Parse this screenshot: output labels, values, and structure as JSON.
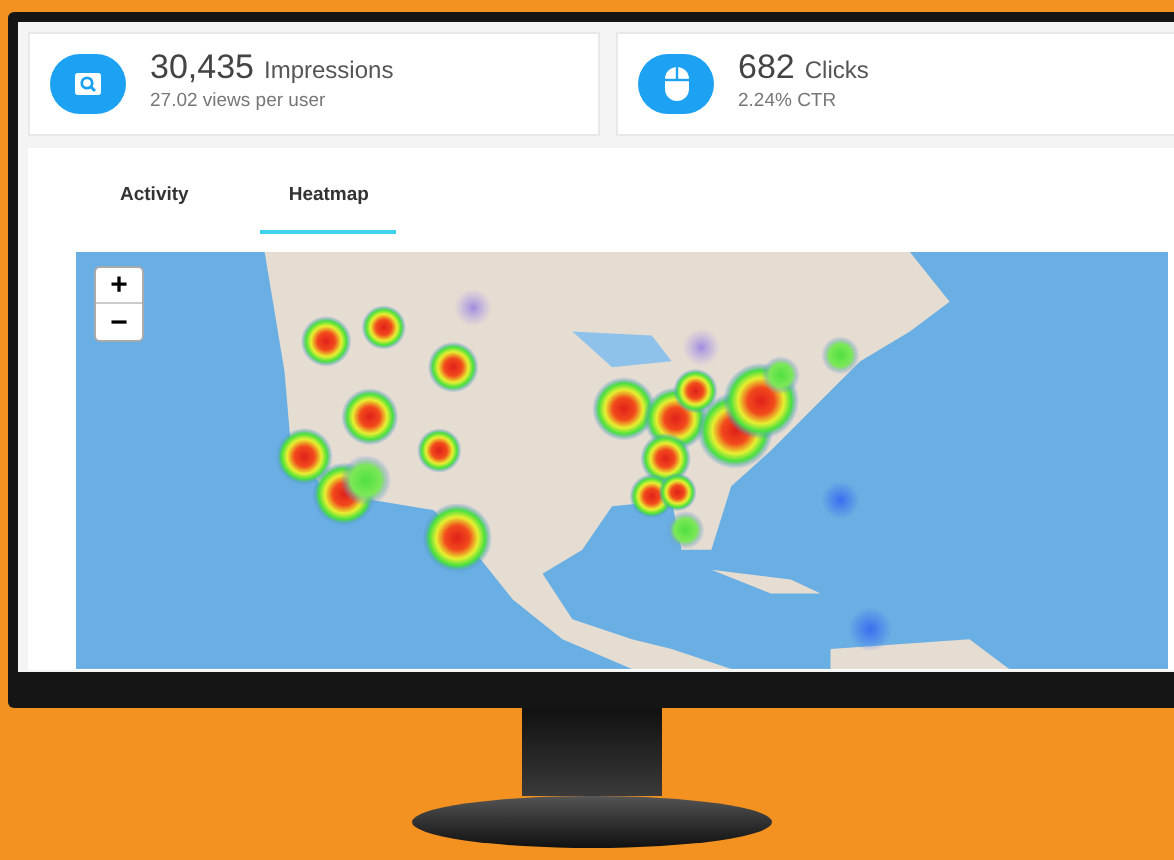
{
  "stats": [
    {
      "kind": "impressions",
      "value": "30,435",
      "label": "Impressions",
      "sub": "27.02 views per user"
    },
    {
      "kind": "clicks",
      "value": "682",
      "label": "Clicks",
      "sub": "2.24% CTR"
    }
  ],
  "tabs": [
    {
      "label": "Activity",
      "selected": false
    },
    {
      "label": "Heatmap",
      "selected": true
    }
  ],
  "map": {
    "zoom_in": "+",
    "zoom_out": "−"
  }
}
